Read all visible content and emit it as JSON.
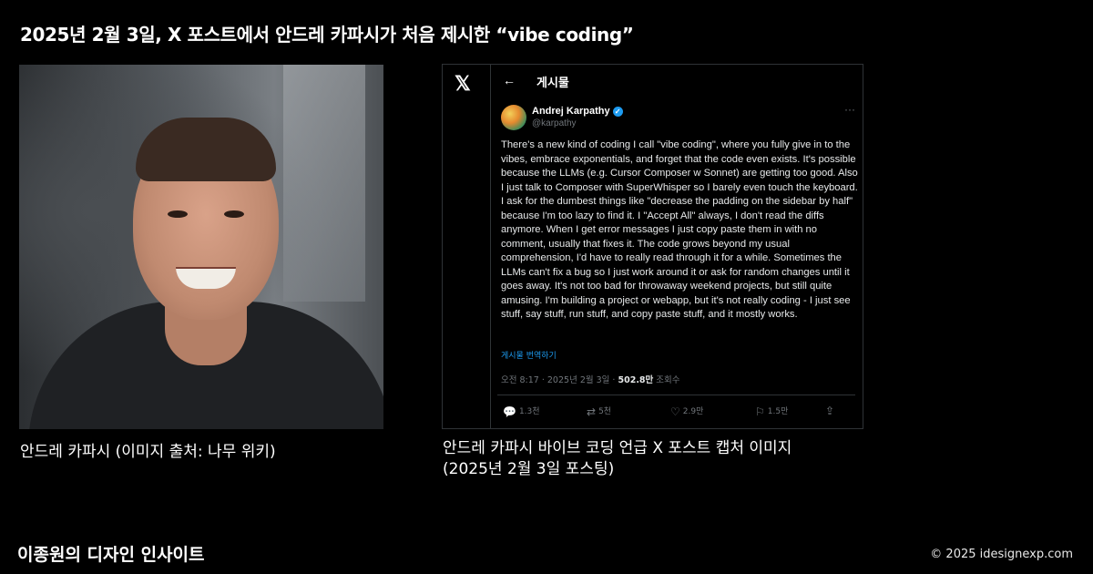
{
  "headline": "2025년 2월 3일, X 포스트에서 안드레 카파시가 처음 제시한 “vibe coding”",
  "photo_caption": "안드레 카파시 (이미지 출처: 나무 위키)",
  "tweet_caption_line1": "안드레 카파시 바이브 코딩 언급 X 포스트 캡처 이미지",
  "tweet_caption_line2": "(2025년 2월 3일 포스팅)",
  "tweet": {
    "logo": "𝕏",
    "back_arrow": "←",
    "page_title": "게시물",
    "author_name": "Andrej Karpathy",
    "verified_mark": "✓",
    "handle": "@karpathy",
    "more": "···",
    "body": "There's a new kind of coding I call \"vibe coding\", where you fully give in to the vibes, embrace exponentials, and forget that the code even exists. It's possible because the LLMs (e.g. Cursor Composer w Sonnet) are getting too good. Also I just talk to Composer with SuperWhisper so I barely even touch the keyboard. I ask for the dumbest things like \"decrease the padding on the sidebar by half\" because I'm too lazy to find it. I \"Accept All\" always, I don't read the diffs anymore. When I get error messages I just copy paste them in with no comment, usually that fixes it. The code grows beyond my usual comprehension, I'd have to really read through it for a while. Sometimes the LLMs can't fix a bug so I just work around it or ask for random changes until it goes away. It's not too bad for throwaway weekend projects, but still quite amusing. I'm building a project or webapp, but it's not really coding - I just see stuff, say stuff, run stuff, and copy paste stuff, and it mostly works.",
    "translate": "게시물 번역하기",
    "time": "오전 8:17 · 2025년 2월 3일 · ",
    "views_count": "502.8만",
    "views_label": " 조회수",
    "replies": "1.3천",
    "reposts": "5천",
    "likes": "2.9만",
    "bookmarks": "1.5만",
    "icons": {
      "reply": "reply-icon",
      "repost": "repost-icon",
      "like": "heart-icon",
      "bookmark": "bookmark-icon",
      "share": "share-icon"
    },
    "accent": "#1d9bf0"
  },
  "footer_left": "이종원의 디자인 인사이트",
  "footer_right": "© 2025 idesignexp.com"
}
